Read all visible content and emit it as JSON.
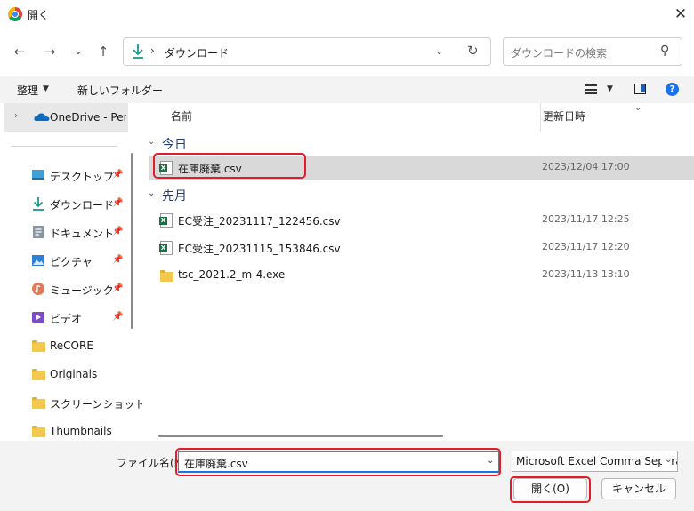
{
  "window": {
    "title": "開く",
    "close_label": "✕"
  },
  "nav": {
    "back_glyph": "←",
    "forward_glyph": "→",
    "recent_glyph": "⌄",
    "up_glyph": "↑",
    "address_separator": "›",
    "address_text": "ダウンロード",
    "refresh_glyph": "↻",
    "search_placeholder": "ダウンロードの検索"
  },
  "toolbar": {
    "organize_label": "整理",
    "new_folder_label": "新しいフォルダー"
  },
  "sidebar": {
    "onedrive_label": "OneDrive - Personal",
    "items": [
      {
        "label": "デスクトップ",
        "icon": "desktop-icon",
        "pinned": true
      },
      {
        "label": "ダウンロード",
        "icon": "download-icon",
        "pinned": true
      },
      {
        "label": "ドキュメント",
        "icon": "document-icon",
        "pinned": true
      },
      {
        "label": "ピクチャ",
        "icon": "pictures-icon",
        "pinned": true
      },
      {
        "label": "ミュージック",
        "icon": "music-icon",
        "pinned": true
      },
      {
        "label": "ビデオ",
        "icon": "video-icon",
        "pinned": true
      },
      {
        "label": "ReCORE",
        "icon": "folder-icon",
        "pinned": false
      },
      {
        "label": "Originals",
        "icon": "folder-icon",
        "pinned": false
      },
      {
        "label": "スクリーンショット",
        "icon": "folder-icon",
        "pinned": false
      },
      {
        "label": "Thumbnails",
        "icon": "folder-icon",
        "pinned": false
      }
    ]
  },
  "list": {
    "columns": {
      "name": "名前",
      "modified": "更新日時"
    },
    "groups": [
      {
        "title": "今日",
        "files": [
          {
            "name": "在庫廃棄.csv",
            "modified": "2023/12/04 17:00",
            "type": "csv",
            "selected": true
          }
        ]
      },
      {
        "title": "先月",
        "files": [
          {
            "name": "EC受注_20231117_122456.csv",
            "modified": "2023/11/17 12:25",
            "type": "csv",
            "selected": false
          },
          {
            "name": "EC受注_20231115_153846.csv",
            "modified": "2023/11/17 12:20",
            "type": "csv",
            "selected": false
          },
          {
            "name": "tsc_2021.2_m-4.exe",
            "modified": "2023/11/13 13:10",
            "type": "folder",
            "selected": false
          }
        ]
      }
    ]
  },
  "footer": {
    "filename_label": "ファイル名(N):",
    "filename_value": "在庫廃棄.csv",
    "filetype_value": "Microsoft Excel Comma Separated Values File",
    "open_label": "開く(O)",
    "cancel_label": "キャンセル"
  },
  "colors": {
    "highlight": "#e01e2b",
    "accent": "#1a73e8",
    "selection": "#d9d9d9"
  }
}
